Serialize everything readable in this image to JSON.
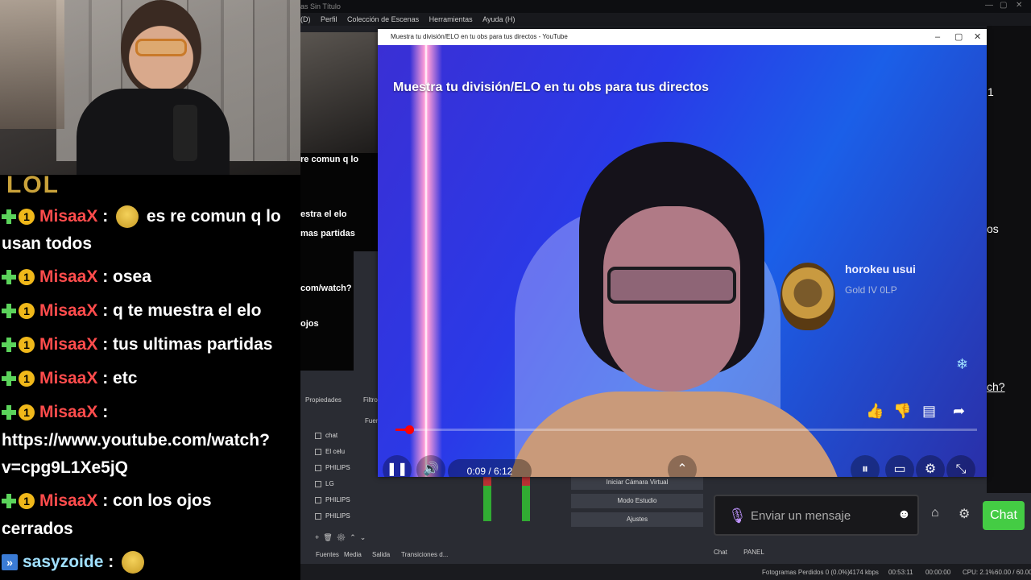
{
  "obs": {
    "window_title": "as Sin Título",
    "menu": [
      "(D)",
      "Perfil",
      "Colección de Escenas",
      "Herramientas",
      "Ayuda (H)"
    ],
    "preview_lines": [
      "re comun q lo",
      "estra el elo",
      "mas partidas",
      "com/watch?",
      "ojos"
    ],
    "dock_tabs": {
      "properties": "Propiedades",
      "filters": "Filtro",
      "sources_header": "Fuent"
    },
    "sources": [
      "chat",
      "El celu",
      "PHILIPS",
      "LG",
      "PHILIPS",
      "PHILIPS"
    ],
    "bottom_tabs": [
      "Fuentes",
      "Media",
      "Salida",
      "Transiciones d..."
    ],
    "controls": [
      "Iniciar Cámara Virtual",
      "Modo Estudio",
      "Ajustes"
    ],
    "status": {
      "dropped": "Fotogramas Perdidos 0 (0.0%)",
      "kbps": "4174 kbps",
      "live_time": "00:53:11",
      "rec_time": "00:00:00",
      "cpu": "CPU: 2.1%",
      "fps": "60.00 / 60.00 FPS"
    }
  },
  "left_chat": {
    "logo": "LOL",
    "messages": [
      {
        "user": "MisaaX",
        "text": "es re comun q lo usan todos",
        "line1": "es re comun q lo",
        "line2": "usan todos"
      },
      {
        "user": "MisaaX",
        "text": "osea"
      },
      {
        "user": "MisaaX",
        "text": "q te muestra el elo"
      },
      {
        "user": "MisaaX",
        "text": "tus ultimas partidas"
      },
      {
        "user": "MisaaX",
        "text": "etc"
      },
      {
        "user": "MisaaX",
        "text": "https://www.youtube.com/watch?v=cpg9L1Xe5jQ",
        "line1": "https://www.youtube.com/watch?",
        "line2": "v=cpg9L1Xe5jQ"
      },
      {
        "user": "MisaaX",
        "text": "con los ojos cerrados",
        "line1": "con los ojos",
        "line2": "cerrados"
      },
      {
        "user": "sasyzoide",
        "text": ""
      }
    ]
  },
  "youtube": {
    "window_title": "Muestra tu división/ELO en tu obs para tus directos - YouTube",
    "video_title": "Muestra tu división/ELO en tu obs para tus directos",
    "rank_name": "horokeu usui",
    "rank_tier": "Gold IV 0LP",
    "time": "0:09 / 6:12",
    "progress": 0.024
  },
  "right_panel": {
    "partial1": "1",
    "partial2": "os",
    "partial3": "ch?"
  },
  "twitch_chat": {
    "placeholder": "Enviar un mensaje",
    "send_label": "Chat",
    "tabs": [
      "Chat",
      "PANEL"
    ]
  }
}
